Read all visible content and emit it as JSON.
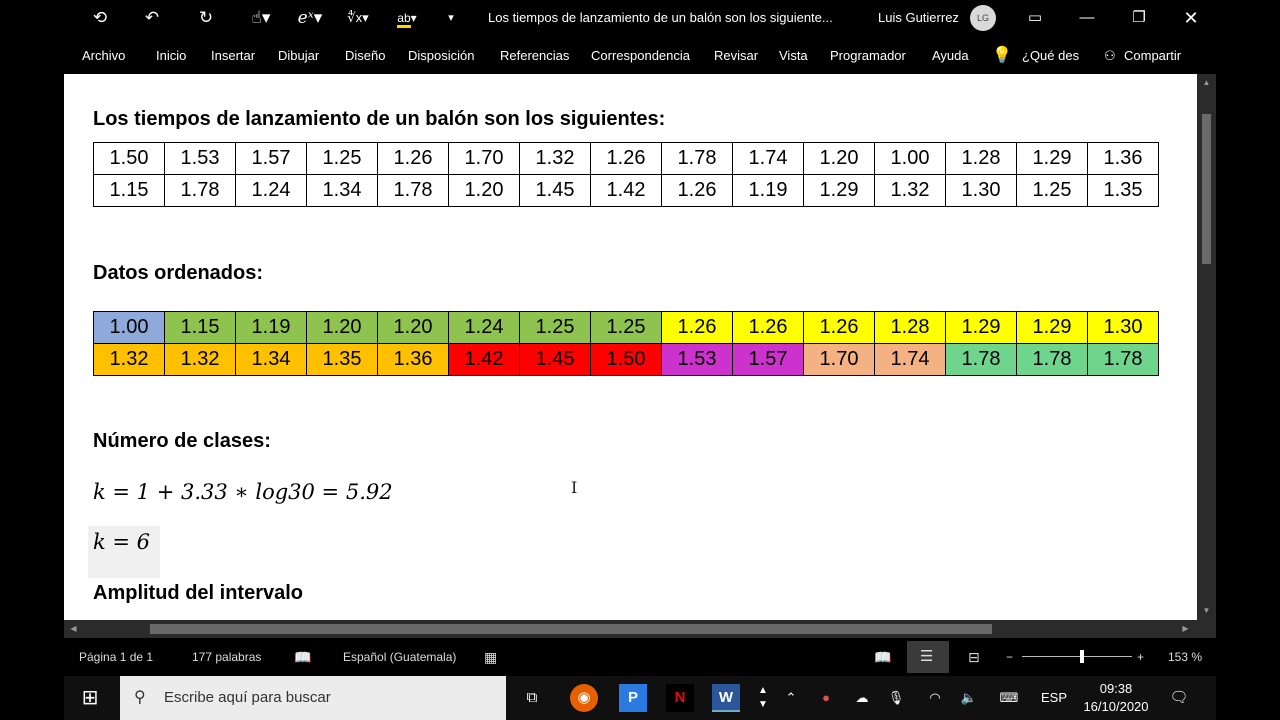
{
  "titlebar": {
    "doc_title": "Los tiempos de lanzamiento de un balón son los siguiente...",
    "user_name": "Luis Gutierrez",
    "user_initials": "LG"
  },
  "ribbon": {
    "tabs": [
      "Archivo",
      "Inicio",
      "Insertar",
      "Dibujar",
      "Diseño",
      "Disposición",
      "Referencias",
      "Correspondencia",
      "Revisar",
      "Vista",
      "Programador",
      "Ayuda"
    ],
    "tell_me": "¿Qué des",
    "share": "Compartir"
  },
  "document": {
    "heading1": "Los tiempos de lanzamiento de un balón son los siguientes:",
    "raw_table": [
      [
        "1.50",
        "1.53",
        "1.57",
        "1.25",
        "1.26",
        "1.70",
        "1.32",
        "1.26",
        "1.78",
        "1.74",
        "1.20",
        "1.00",
        "1.28",
        "1.29",
        "1.36"
      ],
      [
        "1.15",
        "1.78",
        "1.24",
        "1.34",
        "1.78",
        "1.20",
        "1.45",
        "1.42",
        "1.26",
        "1.19",
        "1.29",
        "1.32",
        "1.30",
        "1.25",
        "1.35"
      ]
    ],
    "heading2": "Datos ordenados:",
    "sorted_table": [
      [
        "1.00",
        "1.15",
        "1.19",
        "1.20",
        "1.20",
        "1.24",
        "1.25",
        "1.25",
        "1.26",
        "1.26",
        "1.26",
        "1.28",
        "1.29",
        "1.29",
        "1.30"
      ],
      [
        "1.32",
        "1.32",
        "1.34",
        "1.35",
        "1.36",
        "1.42",
        "1.45",
        "1.50",
        "1.53",
        "1.57",
        "1.70",
        "1.74",
        "1.78",
        "1.78",
        "1.78"
      ]
    ],
    "sorted_colors": [
      [
        "#8eaadb",
        "#8fc350",
        "#8fc350",
        "#8fc350",
        "#8fc350",
        "#8fc350",
        "#8fc350",
        "#8fc350",
        "#ffff00",
        "#ffff00",
        "#ffff00",
        "#ffff00",
        "#ffff00",
        "#ffff00",
        "#ffff00"
      ],
      [
        "#ffc000",
        "#ffc000",
        "#ffc000",
        "#ffc000",
        "#ffc000",
        "#ff0000",
        "#ff0000",
        "#ff0000",
        "#cc33cc",
        "#cc33cc",
        "#f4b183",
        "#f4b183",
        "#70d58c",
        "#70d58c",
        "#70d58c"
      ]
    ],
    "heading3": "Número de clases:",
    "formula1": "k = 1 + 3.33 ∗ log30 = 5.92",
    "formula2": "k = 6",
    "heading4": "Amplitud del intervalo"
  },
  "statusbar": {
    "page": "Página 1 de 1",
    "words": "177 palabras",
    "language": "Español (Guatemala)",
    "zoom": "153 %",
    "zoom_percent": 153
  },
  "taskbar": {
    "search_placeholder": "Escribe aquí para buscar",
    "lang": "ESP",
    "time": "09:38",
    "date": "16/10/2020"
  }
}
